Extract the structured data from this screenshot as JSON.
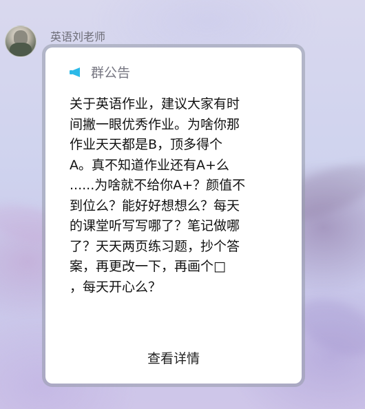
{
  "message": {
    "sender_name": "英语刘老师",
    "avatar_icon": "teacher-avatar",
    "notice_card": {
      "icon": "megaphone-icon",
      "icon_color": "#2bb9e8",
      "title": "群公告",
      "lines": [
        "关于英语作业，建议大家有时",
        "间撇一眼优秀作业。为啥你那",
        "作业天天都是B，顶多得个",
        "A。真不知道作业还有A+么",
        "......为啥就不给你A+？颜值不",
        "到位么？能好好想想么？每天",
        "的课堂听写写哪了？笔记做哪",
        "了？天天两页练习题，抄个答",
        "案，再更改一下，再画个□",
        "，每天开心么？"
      ],
      "detail_link": "查看详情"
    }
  }
}
